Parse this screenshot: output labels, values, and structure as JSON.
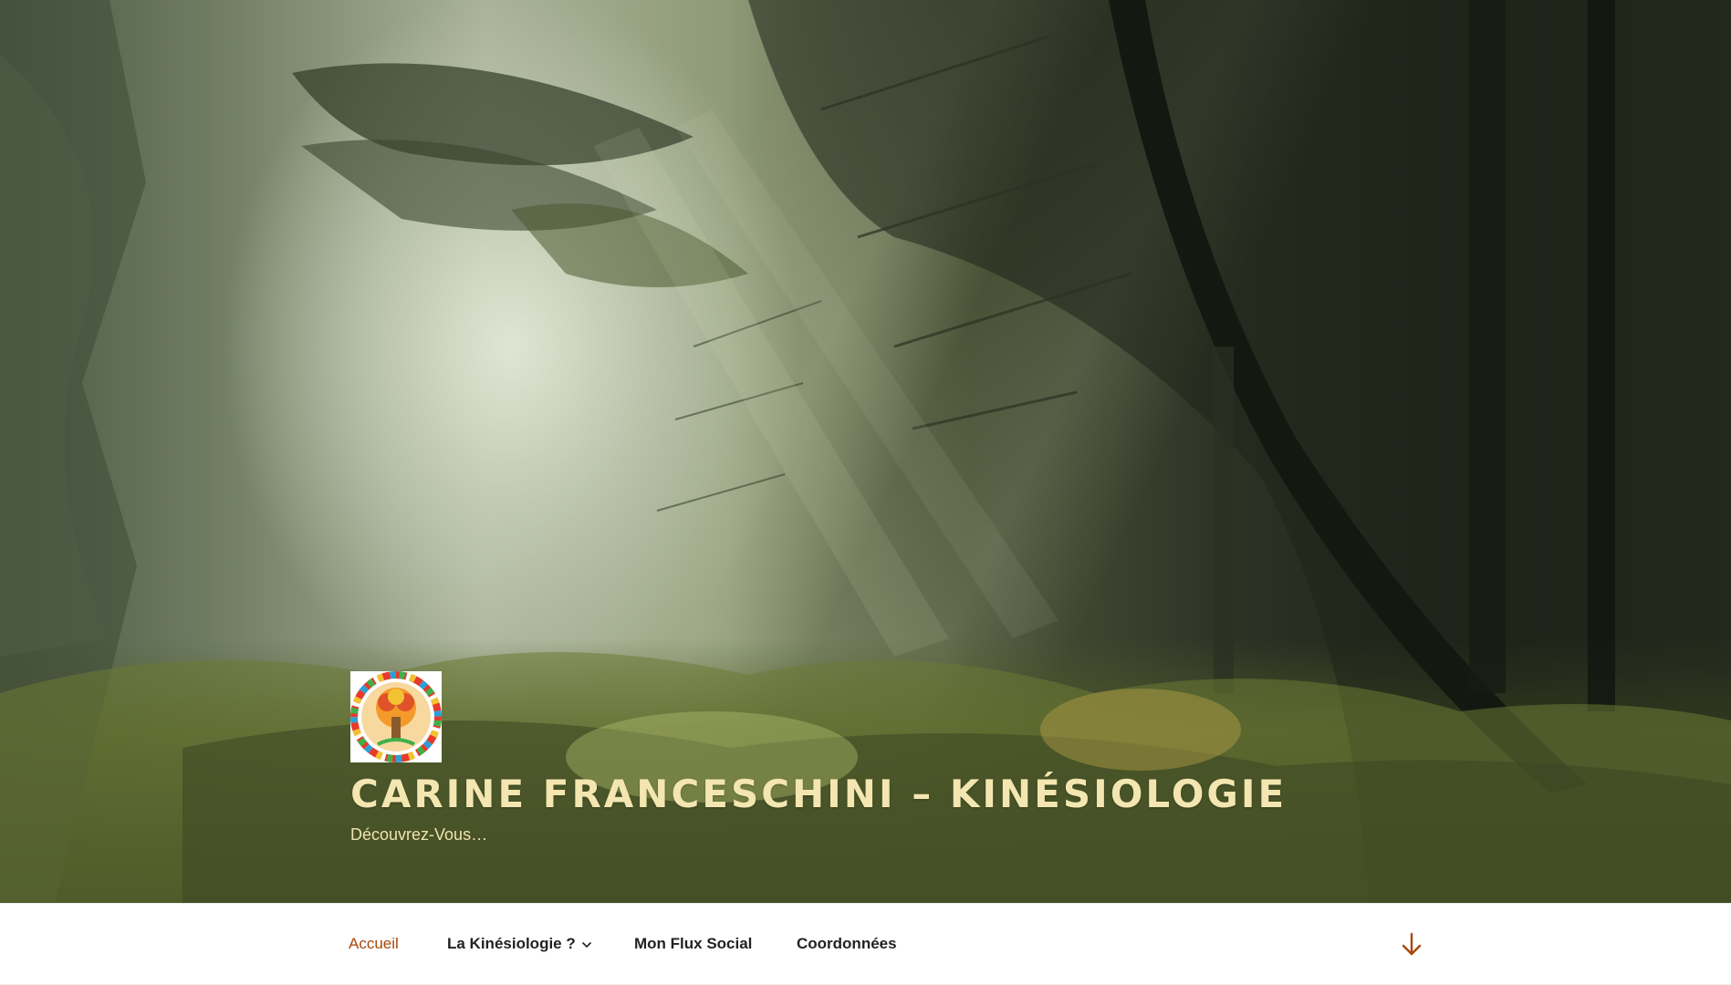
{
  "header": {
    "site_title": "CARINE FRANCESCHINI – KINÉSIOLOGIE",
    "tagline": "Découvrez-Vous…"
  },
  "nav": {
    "items": [
      {
        "label": "Accueil",
        "active": true,
        "has_submenu": false
      },
      {
        "label": "La Kinésiologie ?",
        "active": false,
        "has_submenu": true
      },
      {
        "label": "Mon Flux Social",
        "active": false,
        "has_submenu": false
      },
      {
        "label": "Coordonnées",
        "active": false,
        "has_submenu": false
      }
    ],
    "scroll_icon": "arrow-down-icon"
  },
  "colors": {
    "accent": "#a9470a",
    "title": "#f3e6b0",
    "nav_text": "#222222"
  }
}
